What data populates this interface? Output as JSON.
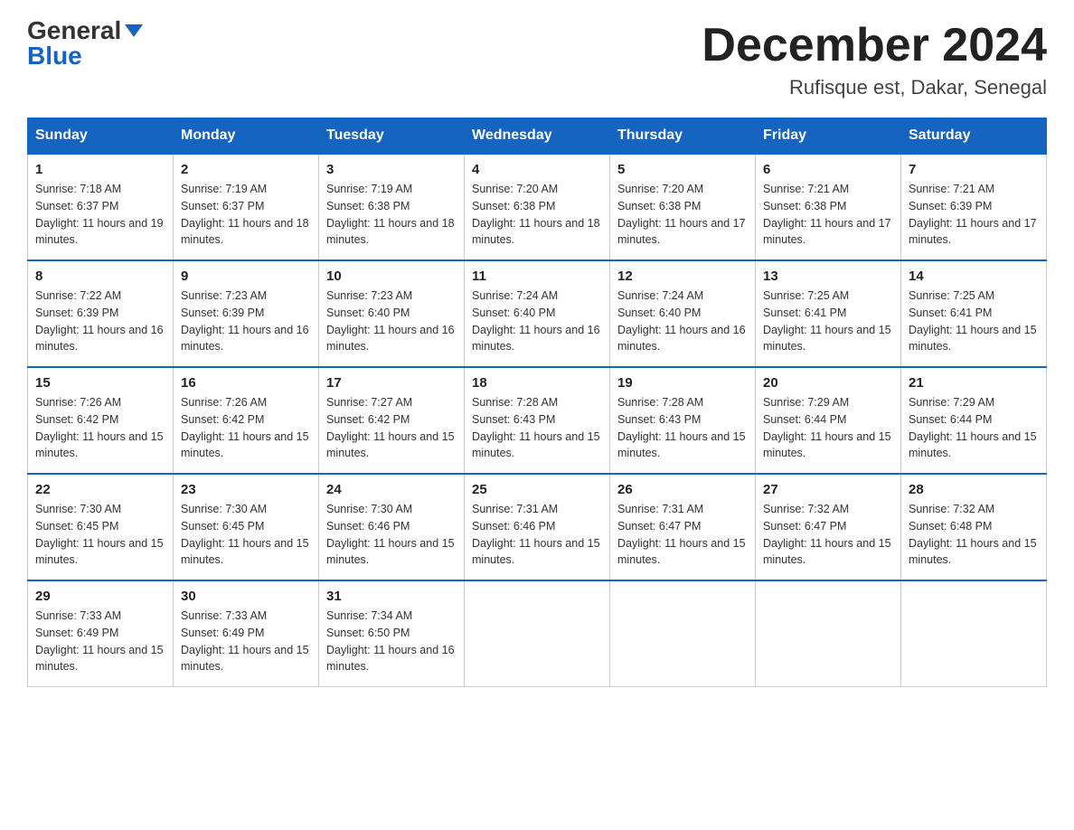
{
  "header": {
    "logo_general": "General",
    "logo_blue": "Blue",
    "month_title": "December 2024",
    "location": "Rufisque est, Dakar, Senegal"
  },
  "weekdays": [
    "Sunday",
    "Monday",
    "Tuesday",
    "Wednesday",
    "Thursday",
    "Friday",
    "Saturday"
  ],
  "weeks": [
    [
      {
        "day": "1",
        "sunrise": "7:18 AM",
        "sunset": "6:37 PM",
        "daylight": "11 hours and 19 minutes."
      },
      {
        "day": "2",
        "sunrise": "7:19 AM",
        "sunset": "6:37 PM",
        "daylight": "11 hours and 18 minutes."
      },
      {
        "day": "3",
        "sunrise": "7:19 AM",
        "sunset": "6:38 PM",
        "daylight": "11 hours and 18 minutes."
      },
      {
        "day": "4",
        "sunrise": "7:20 AM",
        "sunset": "6:38 PM",
        "daylight": "11 hours and 18 minutes."
      },
      {
        "day": "5",
        "sunrise": "7:20 AM",
        "sunset": "6:38 PM",
        "daylight": "11 hours and 17 minutes."
      },
      {
        "day": "6",
        "sunrise": "7:21 AM",
        "sunset": "6:38 PM",
        "daylight": "11 hours and 17 minutes."
      },
      {
        "day": "7",
        "sunrise": "7:21 AM",
        "sunset": "6:39 PM",
        "daylight": "11 hours and 17 minutes."
      }
    ],
    [
      {
        "day": "8",
        "sunrise": "7:22 AM",
        "sunset": "6:39 PM",
        "daylight": "11 hours and 16 minutes."
      },
      {
        "day": "9",
        "sunrise": "7:23 AM",
        "sunset": "6:39 PM",
        "daylight": "11 hours and 16 minutes."
      },
      {
        "day": "10",
        "sunrise": "7:23 AM",
        "sunset": "6:40 PM",
        "daylight": "11 hours and 16 minutes."
      },
      {
        "day": "11",
        "sunrise": "7:24 AM",
        "sunset": "6:40 PM",
        "daylight": "11 hours and 16 minutes."
      },
      {
        "day": "12",
        "sunrise": "7:24 AM",
        "sunset": "6:40 PM",
        "daylight": "11 hours and 16 minutes."
      },
      {
        "day": "13",
        "sunrise": "7:25 AM",
        "sunset": "6:41 PM",
        "daylight": "11 hours and 15 minutes."
      },
      {
        "day": "14",
        "sunrise": "7:25 AM",
        "sunset": "6:41 PM",
        "daylight": "11 hours and 15 minutes."
      }
    ],
    [
      {
        "day": "15",
        "sunrise": "7:26 AM",
        "sunset": "6:42 PM",
        "daylight": "11 hours and 15 minutes."
      },
      {
        "day": "16",
        "sunrise": "7:26 AM",
        "sunset": "6:42 PM",
        "daylight": "11 hours and 15 minutes."
      },
      {
        "day": "17",
        "sunrise": "7:27 AM",
        "sunset": "6:42 PM",
        "daylight": "11 hours and 15 minutes."
      },
      {
        "day": "18",
        "sunrise": "7:28 AM",
        "sunset": "6:43 PM",
        "daylight": "11 hours and 15 minutes."
      },
      {
        "day": "19",
        "sunrise": "7:28 AM",
        "sunset": "6:43 PM",
        "daylight": "11 hours and 15 minutes."
      },
      {
        "day": "20",
        "sunrise": "7:29 AM",
        "sunset": "6:44 PM",
        "daylight": "11 hours and 15 minutes."
      },
      {
        "day": "21",
        "sunrise": "7:29 AM",
        "sunset": "6:44 PM",
        "daylight": "11 hours and 15 minutes."
      }
    ],
    [
      {
        "day": "22",
        "sunrise": "7:30 AM",
        "sunset": "6:45 PM",
        "daylight": "11 hours and 15 minutes."
      },
      {
        "day": "23",
        "sunrise": "7:30 AM",
        "sunset": "6:45 PM",
        "daylight": "11 hours and 15 minutes."
      },
      {
        "day": "24",
        "sunrise": "7:30 AM",
        "sunset": "6:46 PM",
        "daylight": "11 hours and 15 minutes."
      },
      {
        "day": "25",
        "sunrise": "7:31 AM",
        "sunset": "6:46 PM",
        "daylight": "11 hours and 15 minutes."
      },
      {
        "day": "26",
        "sunrise": "7:31 AM",
        "sunset": "6:47 PM",
        "daylight": "11 hours and 15 minutes."
      },
      {
        "day": "27",
        "sunrise": "7:32 AM",
        "sunset": "6:47 PM",
        "daylight": "11 hours and 15 minutes."
      },
      {
        "day": "28",
        "sunrise": "7:32 AM",
        "sunset": "6:48 PM",
        "daylight": "11 hours and 15 minutes."
      }
    ],
    [
      {
        "day": "29",
        "sunrise": "7:33 AM",
        "sunset": "6:49 PM",
        "daylight": "11 hours and 15 minutes."
      },
      {
        "day": "30",
        "sunrise": "7:33 AM",
        "sunset": "6:49 PM",
        "daylight": "11 hours and 15 minutes."
      },
      {
        "day": "31",
        "sunrise": "7:34 AM",
        "sunset": "6:50 PM",
        "daylight": "11 hours and 16 minutes."
      },
      null,
      null,
      null,
      null
    ]
  ]
}
